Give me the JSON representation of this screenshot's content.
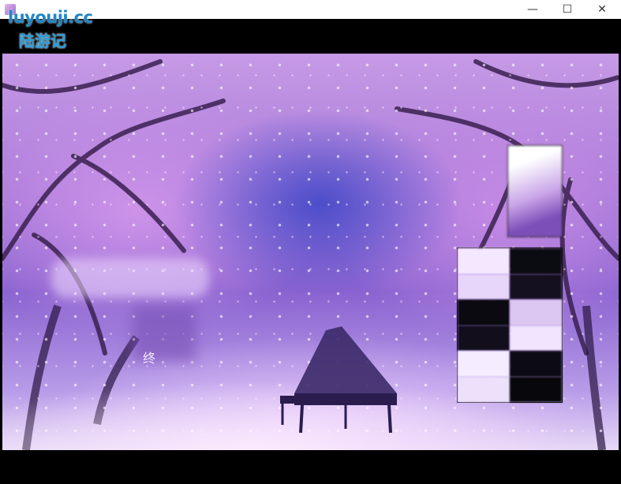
{
  "watermark": {
    "line1": "luyouji.cc",
    "line2": "陆游记"
  },
  "window_controls": {
    "minimize": "—",
    "maximize": "☐",
    "close": "✕"
  },
  "scene": {
    "left_caption": "终"
  },
  "colors": {
    "sky": "#c79ae6",
    "blossom_core": "#3c46c8",
    "letterbox": "#000000"
  }
}
